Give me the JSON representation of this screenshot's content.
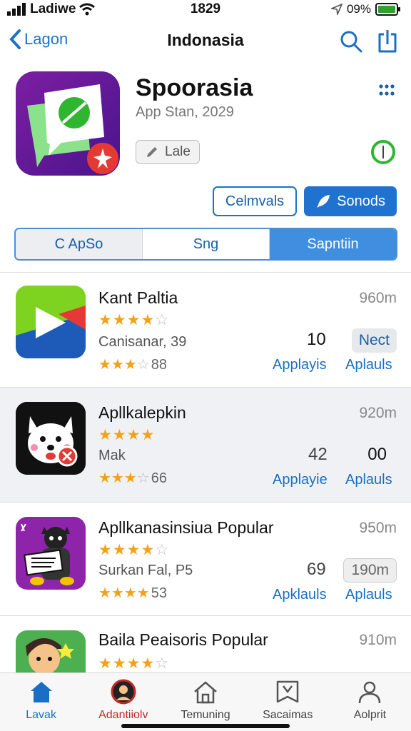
{
  "status": {
    "carrier": "Ladiwe",
    "time": "1829",
    "battery": "09%"
  },
  "nav": {
    "back_label": "Lagon",
    "title": "Indonasia"
  },
  "app": {
    "name": "Spoorasia",
    "subtitle": "App Stan, 2029",
    "rate_label": "Lale"
  },
  "actions": {
    "outline_label": "Celmvals",
    "solid_label": "Sonods"
  },
  "segments": [
    "C ApSo",
    "Sng",
    "Sapntiin"
  ],
  "list": [
    {
      "name": "Kant Paltia",
      "size": "960m",
      "rating_stars": 4,
      "meta": "Canisanar, 39",
      "rating2_stars": 3,
      "rating2_num": "88",
      "count": "10",
      "chip": "Nect",
      "link1": "Applayis",
      "link2": "Aplauls"
    },
    {
      "name": "Apllkalepkin",
      "size": "920m",
      "rating_stars": 4,
      "meta": "Mak",
      "rating2_stars": 3,
      "rating2_num": "66",
      "count": "42",
      "big": "00",
      "link1": "Applayie",
      "link2": "Aplauls"
    },
    {
      "name": "Apllkanasinsiua Popular",
      "size": "950m",
      "rating_stars": 4,
      "meta": "Surkan Fal, P5",
      "rating2_stars": 3.5,
      "rating2_num": "53",
      "count": "69",
      "chip": "190m",
      "link1": "Apklauls",
      "link2": "Aplauls"
    },
    {
      "name": "Baila Peaisoris Popular",
      "size": "910m",
      "rating_stars": 4
    }
  ],
  "tabs": [
    {
      "label": "Lavak",
      "icon": "home-icon"
    },
    {
      "label": "Adantiiolv",
      "icon": "profile-badge-icon"
    },
    {
      "label": "Temuning",
      "icon": "house-outline-icon"
    },
    {
      "label": "Sacaimas",
      "icon": "inbox-icon"
    },
    {
      "label": "Aolprit",
      "icon": "person-icon"
    }
  ],
  "colors": {
    "accent": "#1f72d0",
    "star": "#f2a21a",
    "toggle": "#2fb52f"
  }
}
